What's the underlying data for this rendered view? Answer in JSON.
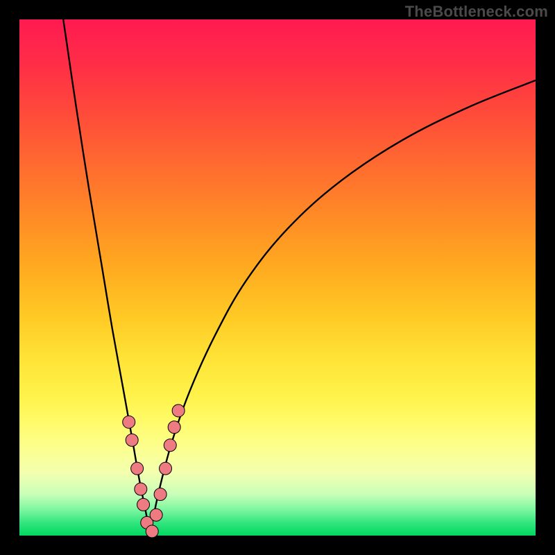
{
  "watermark": {
    "text": "TheBottleneck.com"
  },
  "colors": {
    "frame": "#000000",
    "curve_stroke": "#000000",
    "marker_fill": "#ee7b81",
    "marker_stroke": "#000000"
  },
  "chart_data": {
    "type": "line",
    "title": "",
    "xlabel": "",
    "ylabel": "",
    "xlim": [
      0,
      100
    ],
    "ylim": [
      0,
      100
    ],
    "grid": false,
    "legend": false,
    "note": "No numeric axes or tick labels are visible; values below are fractional positions (0–1) in the plot area, with y measured from the top.",
    "series": [
      {
        "name": "left-branch",
        "x_frac": [
          0.085,
          0.11,
          0.135,
          0.16,
          0.18,
          0.2,
          0.218,
          0.232,
          0.245,
          0.253
        ],
        "y_frac": [
          0.0,
          0.17,
          0.33,
          0.48,
          0.6,
          0.71,
          0.81,
          0.89,
          0.955,
          0.997
        ]
      },
      {
        "name": "right-branch",
        "x_frac": [
          0.253,
          0.27,
          0.295,
          0.33,
          0.38,
          0.44,
          0.52,
          0.62,
          0.74,
          0.87,
          1.0
        ],
        "y_frac": [
          0.997,
          0.915,
          0.82,
          0.72,
          0.61,
          0.505,
          0.405,
          0.315,
          0.235,
          0.17,
          0.118
        ]
      }
    ],
    "markers": {
      "name": "highlighted-points",
      "points_frac": [
        [
          0.212,
          0.78
        ],
        [
          0.218,
          0.815
        ],
        [
          0.228,
          0.87
        ],
        [
          0.235,
          0.91
        ],
        [
          0.24,
          0.94
        ],
        [
          0.247,
          0.975
        ],
        [
          0.257,
          0.992
        ],
        [
          0.265,
          0.96
        ],
        [
          0.273,
          0.92
        ],
        [
          0.283,
          0.87
        ],
        [
          0.292,
          0.825
        ],
        [
          0.3,
          0.79
        ],
        [
          0.308,
          0.758
        ]
      ],
      "radius_px": 9
    }
  }
}
